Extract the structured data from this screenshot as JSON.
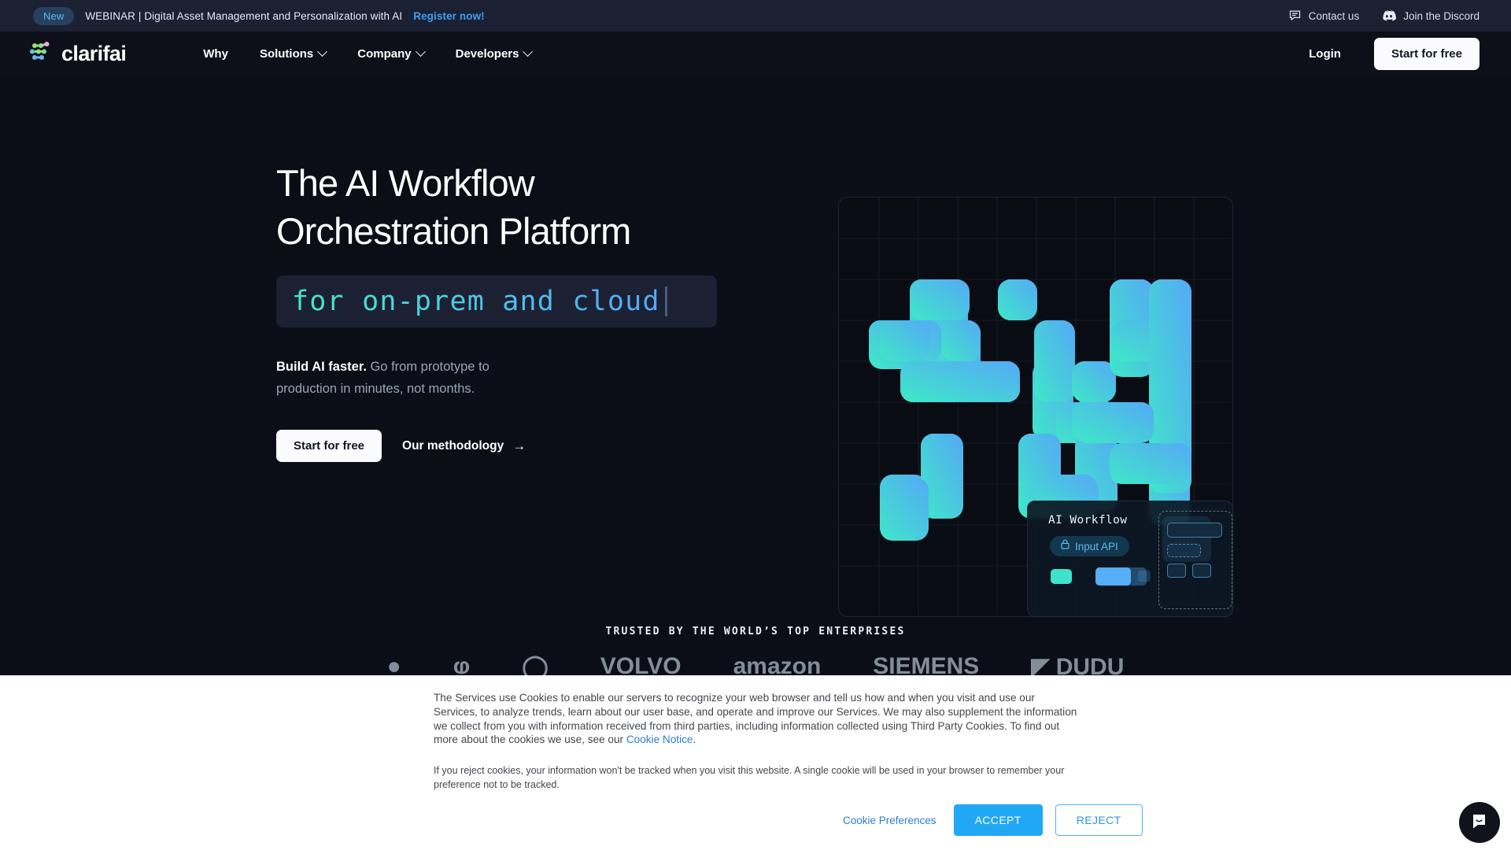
{
  "announcement": {
    "badge": "New",
    "text": "WEBINAR | Digital Asset Management and Personalization with AI",
    "link": "Register now!",
    "contact_label": "Contact us",
    "discord_label": "Join the Discord",
    "contact_icon": "chat-bubble-icon",
    "discord_icon": "discord-icon",
    "bg_color": "#1b2033",
    "link_color": "#3ea0f5"
  },
  "nav": {
    "logo_text": "clarifai",
    "logo_icon": "clarifai-network-logo",
    "links": [
      {
        "label": "Why",
        "has_caret": false
      },
      {
        "label": "Solutions",
        "has_caret": true
      },
      {
        "label": "Company",
        "has_caret": true
      },
      {
        "label": "Developers",
        "has_caret": true
      }
    ],
    "login_label": "Login",
    "cta_label": "Start for free"
  },
  "hero": {
    "heading_line1": "The AI Workflow",
    "heading_line2": "Orchestration Platform",
    "code_text": "for on-prem and cloud",
    "sub_bold": "Build AI faster.",
    "sub_rest": " Go from prototype to production in minutes, not months.",
    "cta_primary": "Start for free",
    "cta_secondary": "Our methodology",
    "cta_secondary_icon": "arrow-right-icon",
    "gradient_start": "#49e4c8",
    "gradient_end": "#55a6f5"
  },
  "workflow_card": {
    "title": "AI Workflow",
    "chip_label": "Input API",
    "chip_icon": "lock-icon",
    "chip_color": "#5bb9f0"
  },
  "trusted": {
    "heading": "TRUSTED BY THE WORLD’S TOP ENTERPRISES",
    "logos": [
      "●",
      "ⱷ",
      "◯",
      "VOLVO",
      "amazon",
      "SIEMENS",
      "◤ DUDU"
    ]
  },
  "cookie_banner": {
    "paragraph1_a": "The Services use Cookies to enable our servers to recognize your web browser and tell us how and when you visit and use our Services, to analyze trends, learn about our user base, and operate and improve our Services. We may also supplement the information we collect from you with information received from third parties, including information collected using Third Party Cookies. To find out more about the cookies we use, see our ",
    "paragraph1_link": "Cookie Notice",
    "paragraph1_b": ".",
    "paragraph2": "If you reject cookies, your information won't be tracked when you visit this website. A single cookie will be used in your browser to remember your preference not to be tracked.",
    "preferences_label": "Cookie Preferences",
    "accept_label": "ACCEPT",
    "reject_label": "REJECT",
    "accept_color": "#20a8f5"
  },
  "intercom": {
    "icon": "intercom-chat-icon"
  }
}
